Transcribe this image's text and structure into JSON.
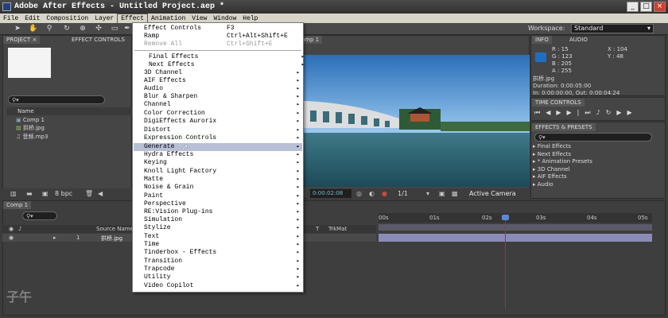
{
  "window": {
    "title": "Adobe After Effects - Untitled Project.aep *",
    "minimize": "_",
    "maximize": "□",
    "close": "×"
  },
  "menubar": [
    "File",
    "Edit",
    "Composition",
    "Layer",
    "Effect",
    "Animation",
    "View",
    "Window",
    "Help"
  ],
  "toolbar": {
    "workspace_label": "Workspace:",
    "workspace_value": "Standard"
  },
  "project_panel": {
    "tabs": [
      "PROJECT ×",
      "EFFECT CONTROLS"
    ],
    "name_header": "Name",
    "items": [
      "Comp 1",
      "拱桥.jpg",
      "音频.mp3"
    ],
    "bpc": "8 bpc"
  },
  "comp_panel": {
    "tab": "Comp 1",
    "timecode": "0:00:02:08",
    "resolution": "1/1",
    "camera": "Active Camera"
  },
  "info_panel": {
    "tabs": [
      "INFO",
      "AUDIO"
    ],
    "r": "R : 15",
    "g": "G : 123",
    "b": "B : 205",
    "a": "A : 255",
    "x": "X : 104",
    "y": "Y : 48",
    "file": "拱桥.jpg",
    "duration": "Duration: 0:00:05:00",
    "inout": "In: 0:00:00:00, Out: 0:00:04:24",
    "swatch_color": "#1e6ec8"
  },
  "time_controls": {
    "tab": "TIME CONTROLS"
  },
  "effects_presets": {
    "tab": "EFFECTS & PRESETS",
    "items": [
      "Final Effects",
      "Next Effects",
      "* Animation Presets",
      "3D Channel",
      "AIF Effects",
      "Audio"
    ]
  },
  "timeline": {
    "tab": "Comp 1",
    "source_name_header": "Source Name",
    "layer_num": "1",
    "layer_name": "拱桥.jpg",
    "t_header": "T",
    "trkmat_header": "TrkMat",
    "ruler": [
      "00s",
      "01s",
      "02s",
      "03s",
      "04s",
      "05s"
    ],
    "playhead_color": "#cc2222"
  },
  "effect_menu": {
    "items": [
      {
        "label": "Effect Controls",
        "shortcut": "F3"
      },
      {
        "label": "Ramp",
        "shortcut": "Ctrl+Alt+Shift+E"
      },
      {
        "label": "Remove All",
        "shortcut": "Ctrl+Shift+E"
      }
    ],
    "submenus": [
      "Final Effects",
      "Next Effects",
      "3D Channel",
      "AIF Effects",
      "Audio",
      "Blur & Sharpen",
      "Channel",
      "Color Correction",
      "DigiEffects Aurorix",
      "Distort",
      "Expression Controls",
      "Generate",
      "Hydra Effects",
      "Keying",
      "Knoll Light Factory",
      "Matte",
      "Noise & Grain",
      "Paint",
      "Perspective",
      "RE:Vision Plug-ins",
      "Simulation",
      "Stylize",
      "Text",
      "Time",
      "Tinderbox - Effects",
      "Transition",
      "Trapcode",
      "Utility",
      "Video Copilot"
    ],
    "highlighted": "Generate"
  }
}
